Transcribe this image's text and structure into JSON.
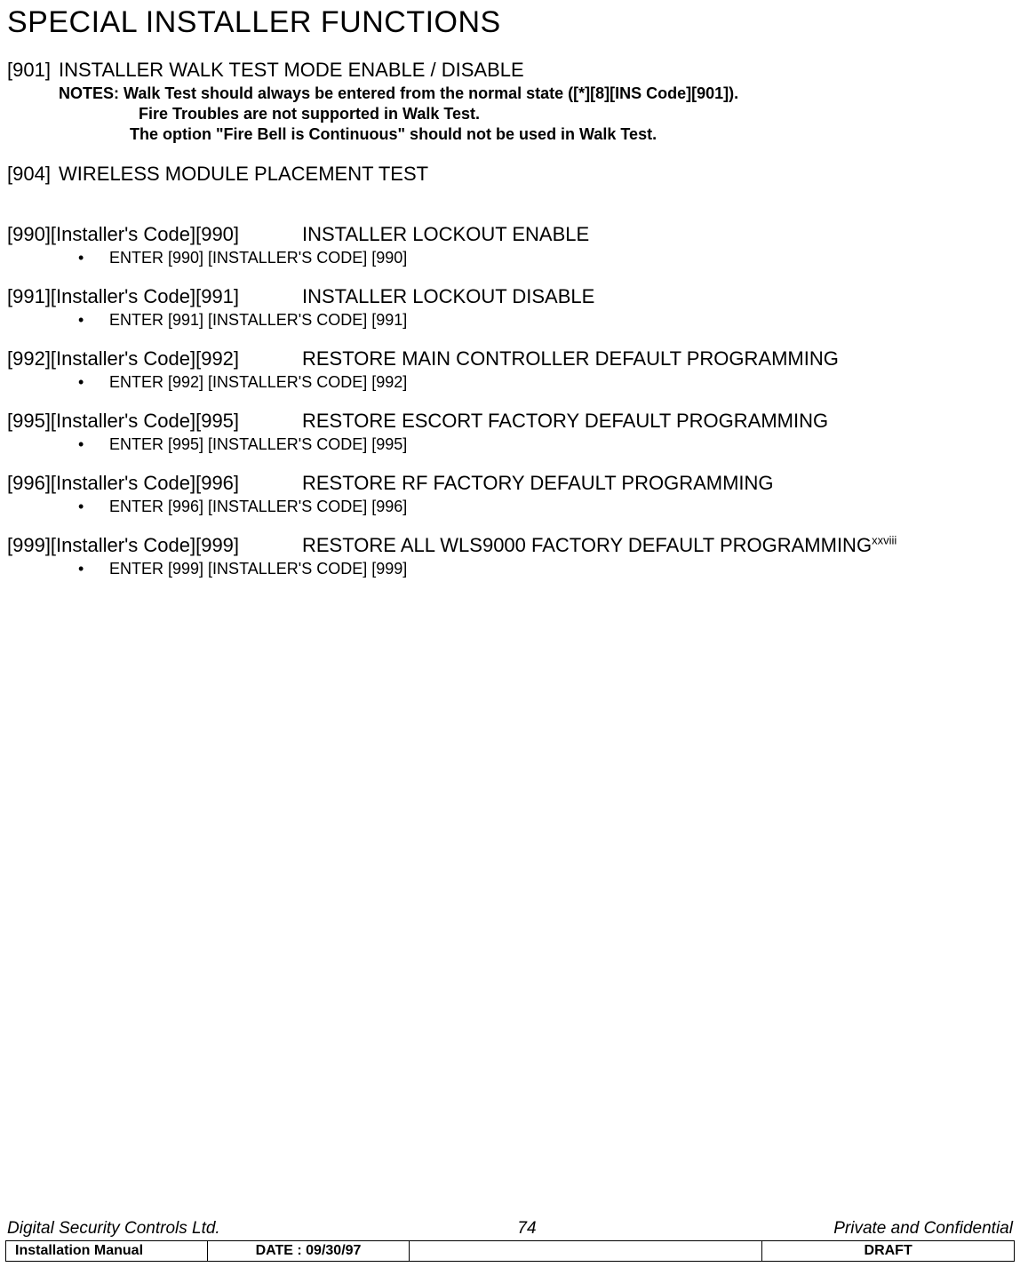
{
  "title": "SPECIAL INSTALLER FUNCTIONS",
  "sec901": {
    "code": "[901]",
    "heading": "INSTALLER WALK TEST MODE ENABLE / DISABLE",
    "notes_label": "NOTES:  ",
    "note1": "Walk Test should always be entered from the normal state ([*][8][INS Code][901]).",
    "note2": "Fire Troubles are not supported in Walk Test.",
    "note3": "The option \"Fire Bell is Continuous\" should not be used in Walk Test."
  },
  "sec904": {
    "code": "[904]",
    "heading": "WIRELESS MODULE PLACEMENT TEST"
  },
  "sec990": {
    "code": "[990][Installer's Code][990]",
    "heading": "INSTALLER LOCKOUT ENABLE",
    "item": "ENTER [990] [INSTALLER'S CODE] [990]"
  },
  "sec991": {
    "code": "[991][Installer's Code][991]",
    "heading": "INSTALLER LOCKOUT DISABLE",
    "item": "ENTER [991] [INSTALLER'S CODE] [991]"
  },
  "sec992": {
    "code": "[992][Installer's Code][992]",
    "heading": "RESTORE MAIN CONTROLLER DEFAULT PROGRAMMING",
    "item": "ENTER [992] [INSTALLER'S CODE] [992]"
  },
  "sec995": {
    "code": "[995][Installer's Code][995]",
    "heading": "RESTORE ESCORT FACTORY DEFAULT PROGRAMMING",
    "item": "ENTER [995] [INSTALLER'S CODE] [995]"
  },
  "sec996": {
    "code": "[996][Installer's Code][996]",
    "heading": "RESTORE RF FACTORY DEFAULT PROGRAMMING",
    "item": "ENTER [996] [INSTALLER'S CODE] [996]"
  },
  "sec999": {
    "code": "[999][Installer's Code][999]",
    "heading": "RESTORE ALL WLS9000 FACTORY DEFAULT PROGRAMMING",
    "sup": "xxviii",
    "item": "ENTER [999] [INSTALLER'S CODE] [999]"
  },
  "bullet": "•",
  "footer": {
    "company": "Digital Security Controls Ltd.",
    "page": "74",
    "confidential": "Private and Confidential",
    "manual": "Installation Manual",
    "date": "DATE :  09/30/97",
    "draft": "DRAFT"
  }
}
